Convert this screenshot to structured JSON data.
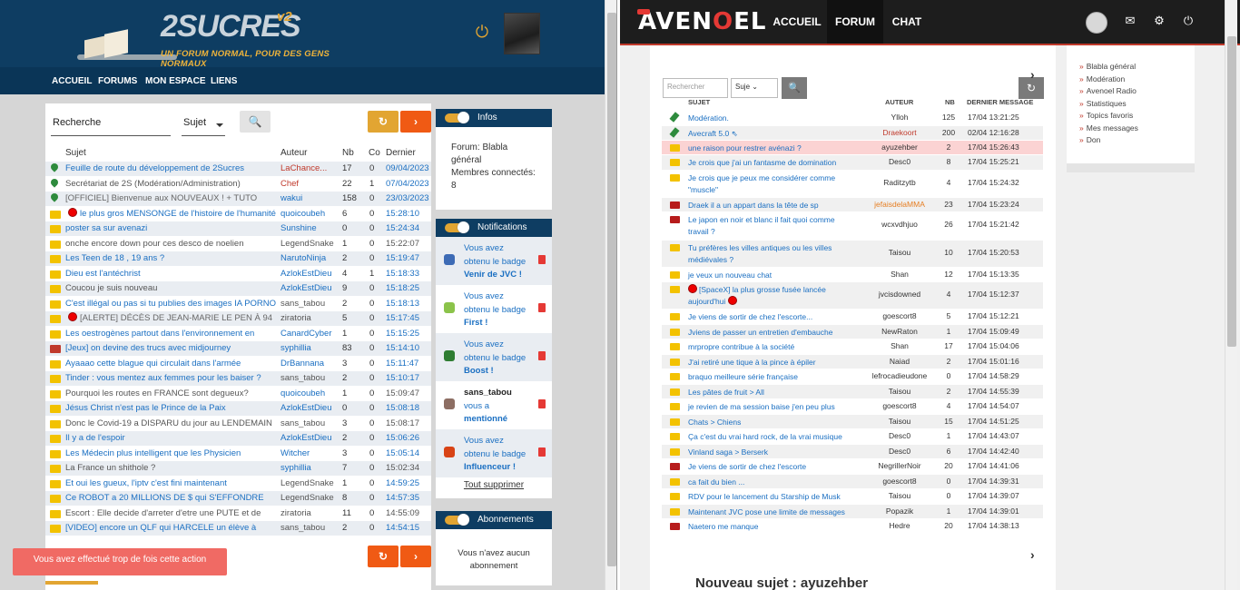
{
  "left": {
    "logo": {
      "title": "2SUCRES",
      "version": "v2",
      "tagline": "UN FORUM NORMAL, POUR DES GENS NORMAUX"
    },
    "nav": [
      "ACCUEIL",
      "FORUMS",
      "MON ESPACE",
      "LIENS"
    ],
    "search": {
      "placeholder": "Recherche",
      "select": "Sujet"
    },
    "headers": {
      "subject": "Sujet",
      "author": "Auteur",
      "nb": "Nb",
      "co": "Co",
      "last": "Dernier"
    },
    "rows": [
      {
        "icon": "pin",
        "subject": "Feuille de route du développement de 2Sucres",
        "author": "LaChance...",
        "nb": "17",
        "co": "0",
        "time": "09/04/2023",
        "sc": "",
        "ac": "red"
      },
      {
        "icon": "pin",
        "subject": "Secrétariat de 2S (Modération/Administration)",
        "author": "Chef",
        "nb": "22",
        "co": "1",
        "time": "07/04/2023",
        "sc": "gray",
        "ac": "red"
      },
      {
        "icon": "pin",
        "subject": "[OFFICIEL] Bienvenue aux NOUVEAUX ! + TUTO",
        "author": "wakui",
        "nb": "158",
        "co": "0",
        "time": "23/03/2023",
        "sc": "gray2",
        "ac": "blue"
      },
      {
        "icon": "folder",
        "dot": true,
        "subject": "le plus gros MENSONGE de l'histoire de l'humanité",
        "author": "quoicoubeh",
        "nb": "6",
        "co": "0",
        "time": "15:28:10",
        "sc": "",
        "ac": "blue"
      },
      {
        "icon": "folder",
        "subject": "poster sa sur avenazi",
        "author": "Sunshine",
        "nb": "0",
        "co": "0",
        "time": "15:24:34",
        "sc": "",
        "ac": "blue"
      },
      {
        "icon": "folder",
        "subject": "onche encore down pour ces desco de noelien",
        "author": "LegendSnake",
        "nb": "1",
        "co": "0",
        "time": "15:22:07",
        "sc": "gray",
        "ac": "",
        "tc": "gray"
      },
      {
        "icon": "folder",
        "subject": "Les Teen de 18 , 19 ans ?",
        "author": "NarutoNinja",
        "nb": "2",
        "co": "0",
        "time": "15:19:47",
        "sc": "",
        "ac": "blue"
      },
      {
        "icon": "folder",
        "subject": "Dieu est l'antéchrist",
        "author": "AzlokEstDieu",
        "nb": "4",
        "co": "1",
        "time": "15:18:33",
        "sc": "",
        "ac": "blue"
      },
      {
        "icon": "folder",
        "subject": "Coucou je suis nouveau",
        "author": "AzlokEstDieu",
        "nb": "9",
        "co": "0",
        "time": "15:18:25",
        "sc": "gray",
        "ac": "blue"
      },
      {
        "icon": "folder",
        "subject": "C'est illégal ou pas si tu publies des images IA PORNO",
        "author": "sans_tabou",
        "nb": "2",
        "co": "0",
        "time": "15:18:13",
        "sc": "",
        "ac": ""
      },
      {
        "icon": "folder",
        "dot": true,
        "subject": "[ALERTE]  DÉCÈS DE JEAN-MARIE LE PEN À 94",
        "author": "ziratoria",
        "nb": "5",
        "co": "0",
        "time": "15:17:45",
        "sc": "gray2",
        "ac": ""
      },
      {
        "icon": "folder",
        "subject": "Les oestrogènes partout dans l'environnement en",
        "author": "CanardCyber",
        "nb": "1",
        "co": "0",
        "time": "15:15:25",
        "sc": "",
        "ac": "blue"
      },
      {
        "icon": "red",
        "subject": "[Jeux] on devine des trucs avec midjourney",
        "author": "syphillia",
        "nb": "83",
        "co": "0",
        "time": "15:14:10",
        "sc": "",
        "ac": "blue"
      },
      {
        "icon": "folder",
        "subject": "Ayaaao cette blague qui circulait dans l'armée",
        "author": "DrBannana",
        "nb": "3",
        "co": "0",
        "time": "15:11:47",
        "sc": "",
        "ac": "blue"
      },
      {
        "icon": "folder",
        "subject": "Tinder : vous mentez aux femmes pour les baiser ?",
        "author": "sans_tabou",
        "nb": "2",
        "co": "0",
        "time": "15:10:17",
        "sc": "",
        "ac": ""
      },
      {
        "icon": "folder",
        "subject": "Pourquoi les routes en FRANCE sont degueux?",
        "author": "quoicoubeh",
        "nb": "1",
        "co": "0",
        "time": "15:09:47",
        "sc": "gray",
        "ac": "blue",
        "tc": "gray"
      },
      {
        "icon": "folder",
        "subject": "Jésus Christ n'est pas le Prince de la Paix",
        "author": "AzlokEstDieu",
        "nb": "0",
        "co": "0",
        "time": "15:08:18",
        "sc": "",
        "ac": "blue"
      },
      {
        "icon": "folder",
        "subject": "Donc le Covid-19 a DISPARU du jour au LENDEMAIN",
        "author": "sans_tabou",
        "nb": "3",
        "co": "0",
        "time": "15:08:17",
        "sc": "gray",
        "ac": "",
        "tc": "gray"
      },
      {
        "icon": "folder",
        "subject": "Il y a de l'espoir",
        "author": "AzlokEstDieu",
        "nb": "2",
        "co": "0",
        "time": "15:06:26",
        "sc": "",
        "ac": "blue"
      },
      {
        "icon": "folder",
        "subject": "Les Médecin plus intelligent que les Physicien",
        "author": "Witcher",
        "nb": "3",
        "co": "0",
        "time": "15:05:14",
        "sc": "",
        "ac": "blue"
      },
      {
        "icon": "folder",
        "subject": "La France un shithole ?",
        "author": "syphillia",
        "nb": "7",
        "co": "0",
        "time": "15:02:34",
        "sc": "gray",
        "ac": "blue",
        "tc": "gray"
      },
      {
        "icon": "folder",
        "subject": "Et oui les gueux, l'iptv c'est fini maintenant",
        "author": "LegendSnake",
        "nb": "1",
        "co": "0",
        "time": "14:59:25",
        "sc": "",
        "ac": ""
      },
      {
        "icon": "folder",
        "subject": "Ce ROBOT a 20 MILLIONS DE $ qui S'EFFONDRE",
        "author": "LegendSnake",
        "nb": "8",
        "co": "0",
        "time": "14:57:35",
        "sc": "",
        "ac": ""
      },
      {
        "icon": "folder",
        "subject": "Escort : Elle decide d'arreter d'etre une PUTE et de",
        "author": "ziratoria",
        "nb": "11",
        "co": "0",
        "time": "14:55:09",
        "sc": "gray",
        "ac": "",
        "tc": "gray"
      },
      {
        "icon": "folder",
        "subject": "[VIDEO] encore un QLF qui HARCELE un élève à",
        "author": "sans_tabou",
        "nb": "2",
        "co": "0",
        "time": "14:54:15",
        "sc": "",
        "ac": ""
      }
    ],
    "infos": {
      "title": "Infos",
      "text1": "Forum: Blabla",
      "text2": "général",
      "text3": "Membres connectés:",
      "text4": "8"
    },
    "notifications": {
      "title": "Notifications",
      "items": [
        {
          "l1": "Vous avez",
          "l2": "obtenu le badge",
          "l3": "Venir de JVC !",
          "color": "#3d6bb5"
        },
        {
          "l1": "Vous avez",
          "l2": "obtenu le badge",
          "l3": "First !",
          "color": "#8bc34a"
        },
        {
          "l1": "Vous avez",
          "l2": "obtenu le badge",
          "l3": "Boost !",
          "color": "#2e7d32"
        },
        {
          "l1": "sans_tabou",
          "l2": "vous a",
          "l3": "mentionné",
          "color": "#8d6e63"
        },
        {
          "l1": "Vous avez",
          "l2": "obtenu le badge",
          "l3": "Influenceur !",
          "color": "#d84315"
        }
      ],
      "clear": "Tout supprimer"
    },
    "subscriptions": {
      "title": "Abonnements",
      "l1": "Vous n'avez aucun",
      "l2": "abonnement"
    },
    "toast": "Vous avez effectué trop de fois cette action"
  },
  "right": {
    "logo": {
      "a": "AVEN",
      "o": "O",
      "b": "EL"
    },
    "nav": [
      "ACCUEIL",
      "FORUM",
      "CHAT"
    ],
    "search_placeholder": "Rechercher",
    "select": "Suje",
    "side_links": [
      "Blabla général",
      "Modération",
      "Avenoel Radio",
      "Statistiques",
      "Topics favoris",
      "Mes messages",
      "Don"
    ],
    "headers": {
      "subject": "SUJET",
      "author": "AUTEUR",
      "nb": "NB",
      "last": "DERNIER MESSAGE"
    },
    "rows": [
      {
        "i": "pin",
        "s": "Modération.",
        "a": "Ylloh",
        "n": "125",
        "d": "17/04 13:21:25",
        "h": 17
      },
      {
        "i": "pin",
        "s": "Avecraft 5.0 ⇖",
        "a": "Draekoort",
        "n": "200",
        "d": "02/04 12:16:28",
        "h": 16,
        "ac": "red"
      },
      {
        "i": "folder",
        "s": "une raison pour restrer avénazi ?",
        "a": "ayuzehber",
        "n": "2",
        "d": "17/04 15:26:43",
        "h": 16,
        "hl": true
      },
      {
        "i": "folder",
        "s": "Je crois que j'ai un fantasme de domination",
        "a": "Desc0",
        "n": "8",
        "d": "17/04 15:25:21",
        "h": 17
      },
      {
        "i": "folder",
        "s": "Je crois que je peux me considérer comme \"muscle\"",
        "a": "Raditzytb",
        "n": "4",
        "d": "17/04 15:24:32",
        "h": 30
      },
      {
        "i": "red",
        "s": "Draek il a un appart dans la tête de sp",
        "a": "jefaisdelaMMA",
        "n": "23",
        "d": "17/04 15:23:24",
        "h": 16,
        "ac": "or"
      },
      {
        "i": "red",
        "s": "Le japon en noir et blanc il fait quoi comme travail ?",
        "a": "wcxvdhjuo",
        "n": "26",
        "d": "17/04 15:21:42",
        "h": 31
      },
      {
        "i": "folder",
        "s": "Tu préfères les villes antiques ou les villes médiévales ?",
        "a": "Taisou",
        "n": "10",
        "d": "17/04 15:20:53",
        "h": 30
      },
      {
        "i": "folder",
        "s": "je veux un nouveau chat",
        "a": "Shan",
        "n": "12",
        "d": "17/04 15:13:35",
        "h": 16
      },
      {
        "i": "folder",
        "s": "[SpaceX] la plus grosse fusée lancée aujourd'hui",
        "a": "jvcisdowned",
        "n": "4",
        "d": "17/04 15:12:37",
        "h": 30,
        "dot": true
      },
      {
        "i": "folder",
        "s": "Je viens de sortir de chez l'escorte...",
        "a": "goescort8",
        "n": "5",
        "d": "17/04 15:12:21",
        "h": 17
      },
      {
        "i": "folder",
        "s": "Jviens de passer un entretien d'embauche",
        "a": "NewRaton",
        "n": "1",
        "d": "17/04 15:09:49",
        "h": 16
      },
      {
        "i": "folder",
        "s": "mrpropre contribue à la société",
        "a": "Shan",
        "n": "17",
        "d": "17/04 15:04:06",
        "h": 17
      },
      {
        "i": "folder",
        "s": "J'ai retiré une tique à la pince à épiler",
        "a": "Naiad",
        "n": "2",
        "d": "17/04 15:01:16",
        "h": 16
      },
      {
        "i": "folder",
        "s": "braquo meilleure série française",
        "a": "lefrocadieudone",
        "n": "0",
        "d": "17/04 14:58:29",
        "h": 17
      },
      {
        "i": "folder",
        "s": "Les pâtes de fruit > All",
        "a": "Taisou",
        "n": "2",
        "d": "17/04 14:55:39",
        "h": 16
      },
      {
        "i": "folder",
        "s": "je revien de ma session baise j'en peu plus",
        "a": "goescort8",
        "n": "4",
        "d": "17/04 14:54:07",
        "h": 17
      },
      {
        "i": "folder",
        "s": "Chats > Chiens",
        "a": "Taisou",
        "n": "15",
        "d": "17/04 14:51:25",
        "h": 16
      },
      {
        "i": "folder",
        "s": "Ça c'est du vrai hard rock, de la vrai musique",
        "a": "Desc0",
        "n": "1",
        "d": "17/04 14:43:07",
        "h": 17
      },
      {
        "i": "folder",
        "s": "Vinland saga > Berserk",
        "a": "Desc0",
        "n": "6",
        "d": "17/04 14:42:40",
        "h": 16
      },
      {
        "i": "red",
        "s": "Je viens de sortir de chez l'escorte",
        "a": "NegrillerNoir",
        "n": "20",
        "d": "17/04 14:41:06",
        "h": 17
      },
      {
        "i": "folder",
        "s": "ca fait du bien ...",
        "a": "goescort8",
        "n": "0",
        "d": "17/04 14:39:31",
        "h": 16
      },
      {
        "i": "folder",
        "s": "RDV pour le lancement du Starship de Musk",
        "a": "Taisou",
        "n": "0",
        "d": "17/04 14:39:07",
        "h": 17
      },
      {
        "i": "folder",
        "s": "Maintenant JVC pose une limite de messages",
        "a": "Popazik",
        "n": "1",
        "d": "17/04 14:39:01",
        "h": 16
      },
      {
        "i": "red",
        "s": "Naetero me manque",
        "a": "Hedre",
        "n": "20",
        "d": "17/04 14:38:13",
        "h": 17
      }
    ],
    "footer_title": "Nouveau sujet : ayuzehber"
  }
}
